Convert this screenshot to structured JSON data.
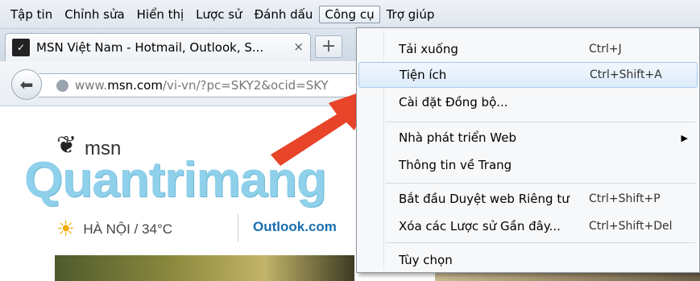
{
  "menubar": {
    "items": [
      {
        "label": "Tập tin"
      },
      {
        "label": "Chỉnh sửa"
      },
      {
        "label": "Hiển thị"
      },
      {
        "label": "Lược sử"
      },
      {
        "label": "Đánh dấu"
      },
      {
        "label": "Công cụ"
      },
      {
        "label": "Trợ giúp"
      }
    ]
  },
  "tab": {
    "title": "MSN Việt Nam - Hotmail, Outlook, S...",
    "close": "×",
    "new_tab": "+"
  },
  "navbar": {
    "url_prefix": "www.",
    "url_domain": "msn.com",
    "url_path": "/vi-vn/?pc=SKY2&ocid=SKY"
  },
  "page": {
    "msn_label": "msn",
    "logo_text": "Quantrimang",
    "weather": "HÀ NỘI / 34°C",
    "outlook_link": "Outlook.com"
  },
  "menu": {
    "items": [
      {
        "label": "Tải xuống",
        "shortcut": "Ctrl+J"
      },
      {
        "label": "Tiện ích",
        "shortcut": "Ctrl+Shift+A"
      },
      {
        "label": "Cài đặt Đồng bộ...",
        "shortcut": ""
      },
      {
        "label": "Nhà phát triển Web",
        "shortcut": ""
      },
      {
        "label": "Thông tin về Trang",
        "shortcut": ""
      },
      {
        "label": "Bắt đầu Duyệt web Riêng tư",
        "shortcut": "Ctrl+Shift+P"
      },
      {
        "label": "Xóa các Lược sử Gần đây...",
        "shortcut": "Ctrl+Shift+Del"
      },
      {
        "label": "Tùy chọn",
        "shortcut": ""
      }
    ]
  },
  "colors": {
    "arrow": "#e8442a",
    "highlight": "#dcebfb",
    "link": "#1a6fb0"
  }
}
